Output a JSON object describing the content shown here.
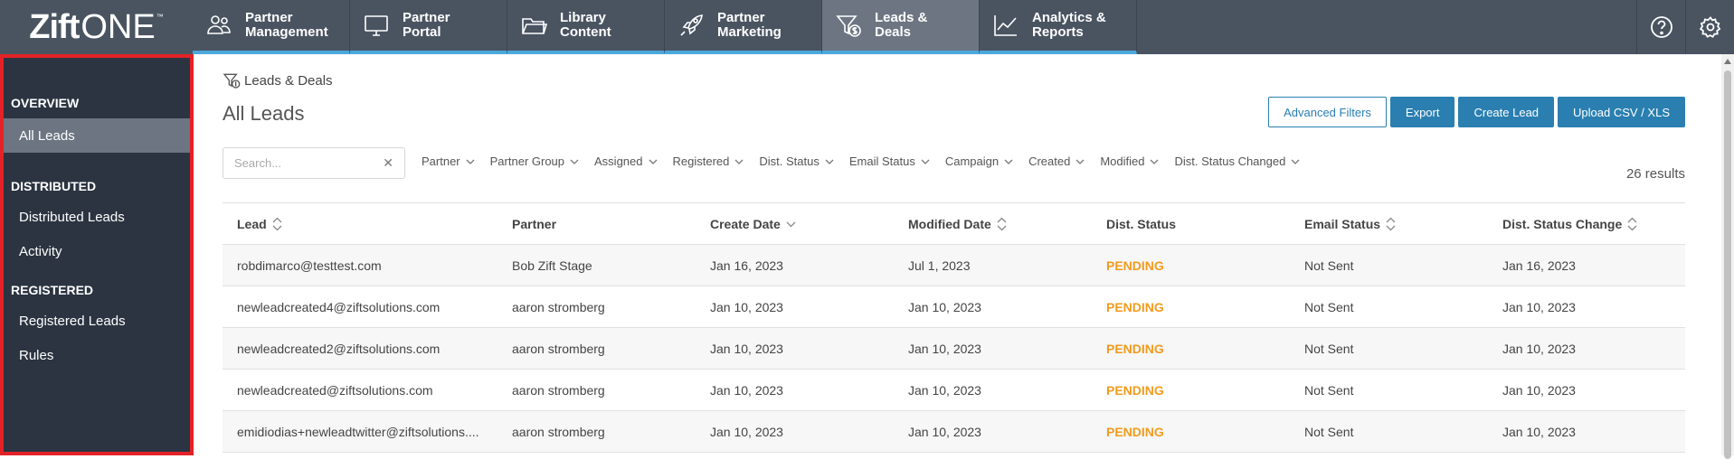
{
  "logo": {
    "zift": "Zift",
    "one": "ONE",
    "tm": "™"
  },
  "nav": {
    "tabs": [
      {
        "label": "Partner\nManagement",
        "icon": "partners-icon"
      },
      {
        "label": "Partner\nPortal",
        "icon": "monitor-icon"
      },
      {
        "label": "Library\nContent",
        "icon": "folder-icon"
      },
      {
        "label": "Partner\nMarketing",
        "icon": "rocket-icon"
      },
      {
        "label": "Leads &\nDeals",
        "icon": "funnel-dollar-icon",
        "active": true
      },
      {
        "label": "Analytics &\nReports",
        "icon": "line-chart-icon"
      }
    ],
    "right_icons": [
      "help-icon",
      "gear-icon"
    ]
  },
  "sidebar": {
    "sections": [
      {
        "title": "OVERVIEW",
        "items": [
          {
            "label": "All Leads",
            "active": true
          }
        ]
      },
      {
        "title": "DISTRIBUTED",
        "items": [
          {
            "label": "Distributed Leads"
          },
          {
            "label": "Activity"
          }
        ]
      },
      {
        "title": "REGISTERED",
        "items": [
          {
            "label": "Registered Leads"
          },
          {
            "label": "Rules"
          }
        ]
      }
    ]
  },
  "main": {
    "breadcrumb": "Leads & Deals",
    "title": "All Leads",
    "actions": {
      "advanced_filters": "Advanced Filters",
      "export": "Export",
      "create_lead": "Create Lead",
      "upload": "Upload CSV / XLS"
    },
    "search": {
      "placeholder": "Search...",
      "value": ""
    },
    "filters": [
      "Partner",
      "Partner Group",
      "Assigned",
      "Registered",
      "Dist. Status",
      "Email Status",
      "Campaign",
      "Created",
      "Modified",
      "Dist. Status Changed"
    ],
    "results": "26 results",
    "table": {
      "columns": [
        {
          "label": "Lead",
          "sort": "both"
        },
        {
          "label": "Partner",
          "sort": "none"
        },
        {
          "label": "Create Date",
          "sort": "down"
        },
        {
          "label": "Modified Date",
          "sort": "both"
        },
        {
          "label": "Dist. Status",
          "sort": "none"
        },
        {
          "label": "Email Status",
          "sort": "both"
        },
        {
          "label": "Dist. Status Change",
          "sort": "both"
        }
      ],
      "rows": [
        [
          "robdimarco@testtest.com",
          "Bob Zift Stage",
          "Jan 16, 2023",
          "Jul 1, 2023",
          "PENDING",
          "Not Sent",
          "Jan 16, 2023"
        ],
        [
          "newleadcreated4@ziftsolutions.com",
          "aaron stromberg",
          "Jan 10, 2023",
          "Jan 10, 2023",
          "PENDING",
          "Not Sent",
          "Jan 10, 2023"
        ],
        [
          "newleadcreated2@ziftsolutions.com",
          "aaron stromberg",
          "Jan 10, 2023",
          "Jan 10, 2023",
          "PENDING",
          "Not Sent",
          "Jan 10, 2023"
        ],
        [
          "newleadcreated@ziftsolutions.com",
          "aaron stromberg",
          "Jan 10, 2023",
          "Jan 10, 2023",
          "PENDING",
          "Not Sent",
          "Jan 10, 2023"
        ],
        [
          "emidiodias+newleadtwitter@ziftsolutions....",
          "aaron stromberg",
          "Jan 10, 2023",
          "Jan 10, 2023",
          "PENDING",
          "Not Sent",
          "Jan 10, 2023"
        ]
      ]
    }
  },
  "colors": {
    "nav_bg": "#4a5461",
    "sidebar_bg": "#2c3441",
    "accent": "#2a7fb0",
    "pending": "#f29b1d",
    "highlight_border": "#e32228"
  }
}
